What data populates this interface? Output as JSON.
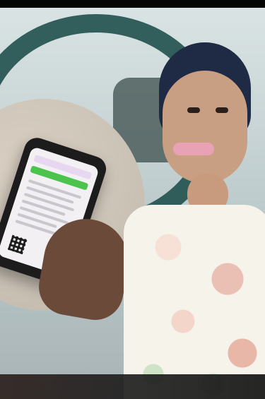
{
  "image": {
    "subject": "",
    "accent_colors": {
      "teal": "#24524f",
      "green_bar": "#4bc34d",
      "lavender_header": "#e8d7f1",
      "lip_pink": "#e7a3b5",
      "hair_navy": "#1f2a44"
    }
  }
}
